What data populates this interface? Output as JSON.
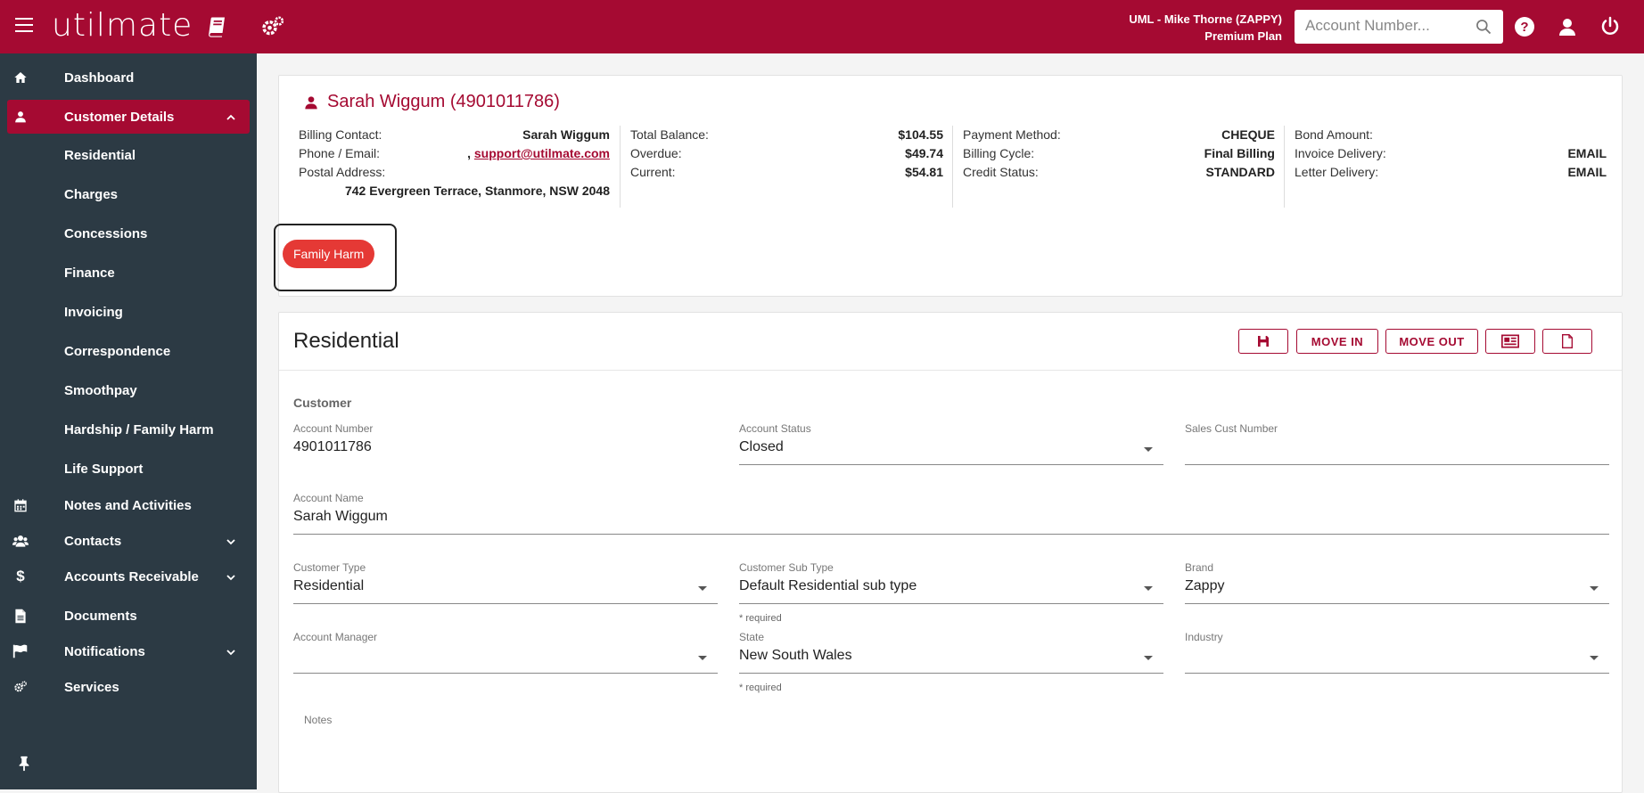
{
  "header": {
    "logo": "utilmate",
    "user_line1": "UML - Mike Thorne (ZAPPY)",
    "user_line2": "Premium Plan",
    "search_placeholder": "Account Number..."
  },
  "sidebar": {
    "dashboard": "Dashboard",
    "customer_details": "Customer Details",
    "sub_items": [
      "Residential",
      "Charges",
      "Concessions",
      "Finance",
      "Invoicing",
      "Correspondence",
      "Smoothpay",
      "Hardship / Family Harm",
      "Life Support"
    ],
    "notes_activities": "Notes and Activities",
    "contacts": "Contacts",
    "accounts_receivable": "Accounts Receivable",
    "documents": "Documents",
    "notifications": "Notifications",
    "services": "Services"
  },
  "customer": {
    "title": "Sarah Wiggum (4901011786)",
    "billing_contact_label": "Billing Contact:",
    "billing_contact": "Sarah Wiggum",
    "phone_email_label": "Phone / Email:",
    "phone_email_prefix": ", ",
    "email": "support@utilmate.com",
    "postal_label": "Postal Address:",
    "postal": "742 Evergreen Terrace, Stanmore, NSW 2048",
    "total_balance_label": "Total Balance:",
    "total_balance": "$104.55",
    "overdue_label": "Overdue:",
    "overdue": "$49.74",
    "current_label": "Current:",
    "current": "$54.81",
    "payment_method_label": "Payment Method:",
    "payment_method": "CHEQUE",
    "billing_cycle_label": "Billing Cycle:",
    "billing_cycle": "Final Billing",
    "credit_status_label": "Credit Status:",
    "credit_status": "STANDARD",
    "bond_label": "Bond Amount:",
    "bond": "",
    "invoice_delivery_label": "Invoice Delivery:",
    "invoice_delivery": "EMAIL",
    "letter_delivery_label": "Letter Delivery:",
    "letter_delivery": "EMAIL",
    "badge": "Family Harm"
  },
  "residential": {
    "title": "Residential",
    "move_in": "MOVE IN",
    "move_out": "MOVE OUT",
    "section": "Customer",
    "account_number_label": "Account Number",
    "account_number": "4901011786",
    "account_status_label": "Account Status",
    "account_status": "Closed",
    "sales_cust_label": "Sales Cust Number",
    "sales_cust": "",
    "account_name_label": "Account Name",
    "account_name": "Sarah Wiggum",
    "customer_type_label": "Customer Type",
    "customer_type": "Residential",
    "customer_sub_type_label": "Customer Sub Type",
    "customer_sub_type": "Default Residential sub type",
    "brand_label": "Brand",
    "brand": "Zappy",
    "required": "* required",
    "account_manager_label": "Account Manager",
    "account_manager": "",
    "state_label": "State",
    "state": "New South Wales",
    "industry_label": "Industry",
    "industry": "",
    "notes_label": "Notes"
  }
}
